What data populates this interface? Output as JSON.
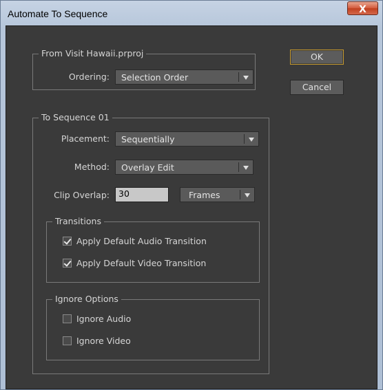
{
  "window": {
    "title": "Automate To Sequence",
    "close_label": "X"
  },
  "source_group": {
    "legend": "From Visit Hawaii.prproj",
    "ordering_label": "Ordering:",
    "ordering_value": "Selection Order"
  },
  "buttons": {
    "ok_label": "OK",
    "cancel_label": "Cancel"
  },
  "sequence_group": {
    "legend": "To Sequence 01",
    "placement_label": "Placement:",
    "placement_value": "Sequentially",
    "method_label": "Method:",
    "method_value": "Overlay Edit",
    "clip_overlap_label": "Clip Overlap:",
    "clip_overlap_value": "30",
    "clip_overlap_unit": "Frames"
  },
  "transitions": {
    "legend": "Transitions",
    "audio_label": "Apply Default Audio Transition",
    "audio_checked": true,
    "video_label": "Apply Default Video Transition",
    "video_checked": true
  },
  "ignore_options": {
    "legend": "Ignore Options",
    "audio_label": "Ignore Audio",
    "audio_checked": false,
    "video_label": "Ignore Video",
    "video_checked": false
  },
  "colors": {
    "panel": "#3a3a3a",
    "default_button_border": "#c79a2e"
  }
}
